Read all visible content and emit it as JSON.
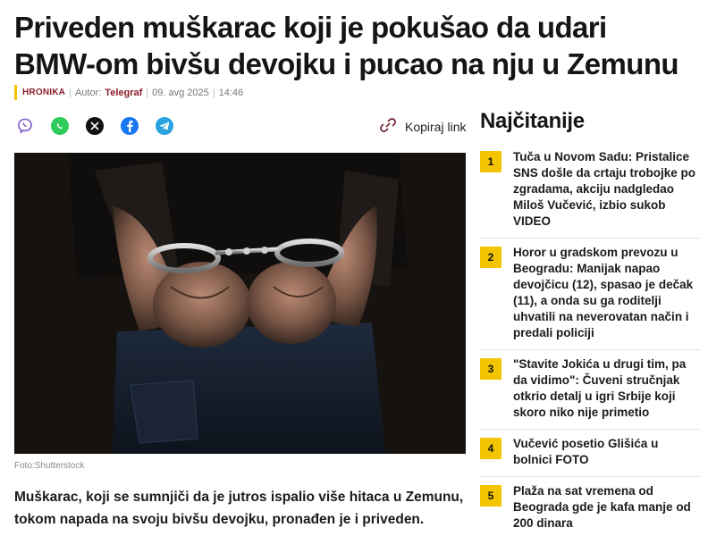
{
  "article": {
    "headline": "Priveden muškarac koji je pokušao da udari BMW-om bivšu devojku i pucao na nju u Zemunu",
    "category": "HRONIKA",
    "author_label": "Autor:",
    "author": "Telegraf",
    "date": "09. avg 2025",
    "time": "14:46",
    "photo_caption": "Foto:Shutterstock",
    "lead": "Muškarac, koji se sumnjiči da je jutros ispalio više hitaca u Zemunu, tokom napada na svoju bivšu devojku, pronađen je i priveden."
  },
  "share": {
    "icons": [
      "viber-icon",
      "whatsapp-icon",
      "x-icon",
      "facebook-icon",
      "telegram-icon"
    ],
    "copy_label": "Kopiraj link"
  },
  "sidebar": {
    "title": "Najčitanije",
    "items": [
      {
        "num": "1",
        "title": "Tuča u Novom Sadu: Pristalice SNS došle da crtaju trobojke po zgradama, akciju nadgledao Miloš Vučević, izbio sukob VIDEO"
      },
      {
        "num": "2",
        "title": "Horor u gradskom prevozu u Beogradu: Manijak napao devojčicu (12), spasao je dečak (11), a onda su ga roditelji uhvatili na neverovatan način i predali policiji"
      },
      {
        "num": "3",
        "title": "\"Stavite Jokića u drugi tim, pa da vidimo\": Čuveni stručnjak otkrio detalj u igri Srbije koji skoro niko nije primetio"
      },
      {
        "num": "4",
        "title": "Vučević posetio Glišića u bolnici FOTO"
      },
      {
        "num": "5",
        "title": "Plaža na sat vremena od Beograda gde je kafa manje od 200 dinara"
      }
    ]
  },
  "colors": {
    "accent_yellow": "#f5c400",
    "category_red": "#8a1e2b"
  }
}
